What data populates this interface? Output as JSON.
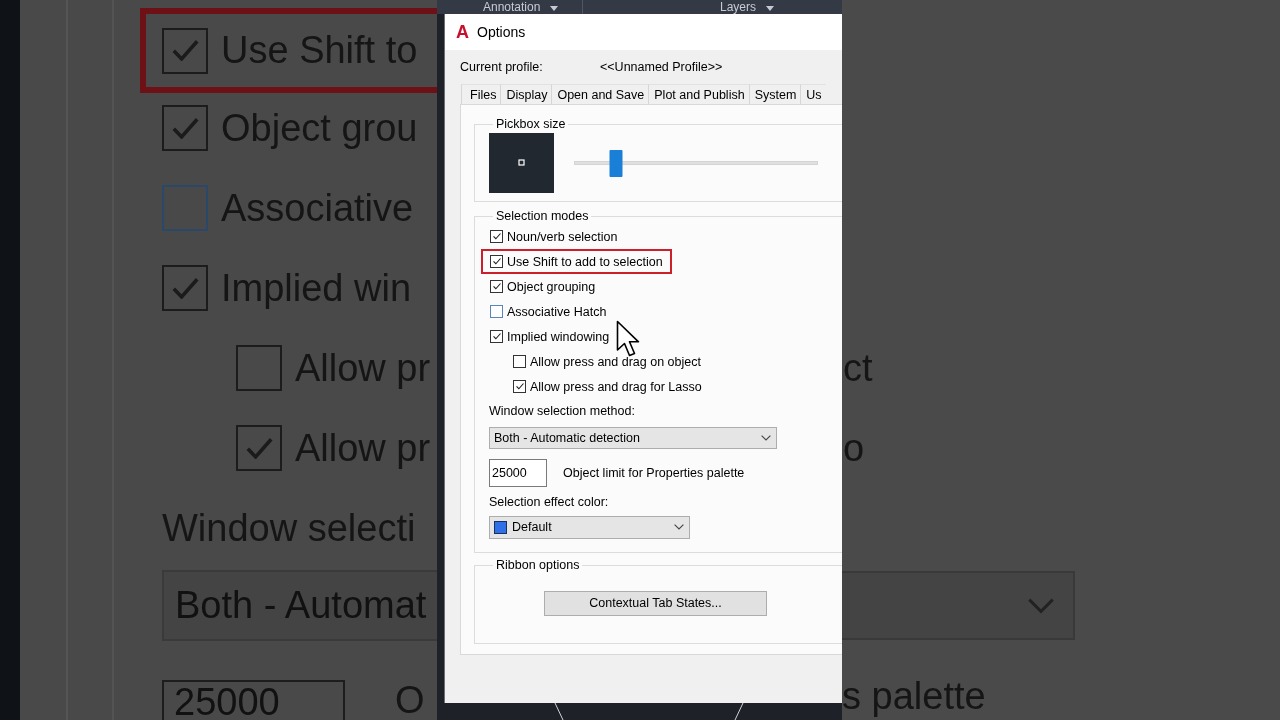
{
  "backdrop_left": {
    "checkboxes": [
      {
        "label": "Use Shift to",
        "checked": true,
        "hovered": false,
        "highlighted": true
      },
      {
        "label": "Object grou",
        "checked": true,
        "hovered": false,
        "highlighted": false
      },
      {
        "label": "Associative",
        "checked": false,
        "hovered": true,
        "highlighted": false
      },
      {
        "label": "Implied win",
        "checked": true,
        "hovered": false,
        "highlighted": false,
        "children": [
          {
            "label": "Allow pr",
            "checked": false,
            "hovered": false,
            "highlighted": false
          },
          {
            "label": "Allow pr",
            "checked": true,
            "hovered": false,
            "highlighted": false
          }
        ]
      }
    ],
    "window_selection_label": "Window selecti",
    "window_selection_dropdown": {
      "value": "Both - Automat"
    },
    "object_limit_field": {
      "value": "25000"
    },
    "object_limit_label": "O"
  },
  "ribbon": {
    "panels": [
      {
        "label": "Annotation"
      },
      {
        "label": "Layers"
      }
    ]
  },
  "dialog": {
    "logo": "A",
    "title": "Options",
    "current_profile": {
      "label": "Current profile:",
      "value": "<<Unnamed Profile>>"
    },
    "tabs": [
      {
        "label": "Files",
        "selected": false
      },
      {
        "label": "Display",
        "selected": false
      },
      {
        "label": "Open and Save",
        "selected": false
      },
      {
        "label": "Plot and Publish",
        "selected": false
      },
      {
        "label": "System",
        "selected": false
      },
      {
        "label": "Us",
        "selected": false
      }
    ],
    "pickbox": {
      "title": "Pickbox size",
      "slider": {
        "level": 0.17
      }
    },
    "selection_modes": {
      "title": "Selection modes",
      "checkboxes": [
        {
          "label": "Noun/verb selection",
          "checked": true,
          "hovered": false,
          "highlighted": false
        },
        {
          "label": "Use Shift to add to selection",
          "checked": true,
          "hovered": false,
          "highlighted": true
        },
        {
          "label": "Object grouping",
          "checked": true,
          "hovered": false,
          "highlighted": false
        },
        {
          "label": "Associative Hatch",
          "checked": false,
          "hovered": true,
          "highlighted": false
        },
        {
          "label": "Implied windowing",
          "checked": true,
          "hovered": false,
          "highlighted": false,
          "children": [
            {
              "label": "Allow press and drag on object",
              "checked": false,
              "hovered": false,
              "highlighted": false
            },
            {
              "label": "Allow press and drag for Lasso",
              "checked": true,
              "hovered": false,
              "highlighted": false
            }
          ]
        }
      ],
      "window_selection": {
        "label": "Window selection method:",
        "value": "Both - Automatic detection"
      },
      "object_limit": {
        "value": "25000",
        "label": "Object limit for Properties palette"
      },
      "selection_effect_color": {
        "label": "Selection effect color:",
        "value": "Default",
        "color": "#2f6fe8"
      }
    },
    "ribbon_options": {
      "title": "Ribbon options",
      "button": "Contextual Tab States..."
    }
  },
  "backdrop_right": {
    "checkbox_label_tails": [
      "ct",
      "o"
    ],
    "object_limit_label_tail": "s palette"
  }
}
